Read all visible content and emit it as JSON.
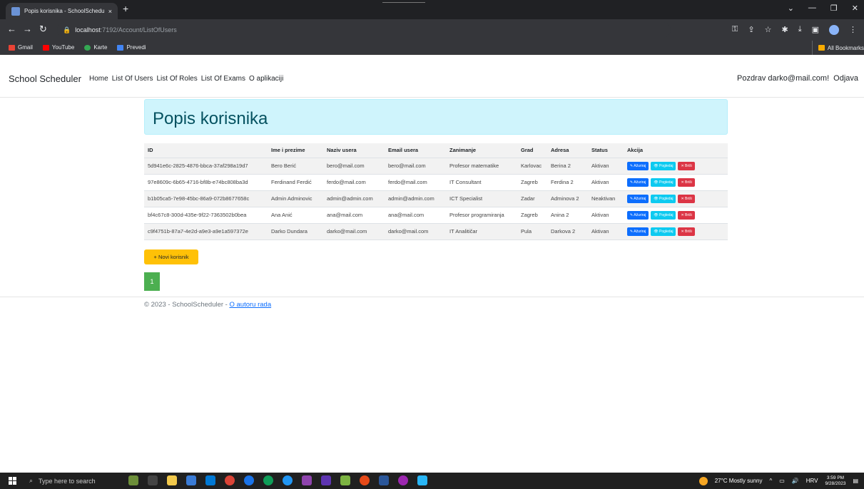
{
  "browser": {
    "tab_title": "Popis korisnika - SchoolScheduler",
    "tab_close": "×",
    "new_tab": "+",
    "url_host": "localhost",
    "url_path": ":7192/Account/ListOfUsers",
    "bookmarks": [
      {
        "label": "Gmail",
        "color": "#ea4335"
      },
      {
        "label": "YouTube",
        "color": "#ff0000"
      },
      {
        "label": "Karte",
        "color": "#34a853"
      },
      {
        "label": "Prevedi",
        "color": "#4285f4"
      }
    ],
    "all_bookmarks": "All Bookmarks"
  },
  "navbar": {
    "brand": "School Scheduler",
    "links": [
      "Home",
      "List Of Users",
      "List Of Roles",
      "List Of Exams",
      "O aplikaciji"
    ],
    "greeting": "Pozdrav darko@mail.com!",
    "logout": "Odjava"
  },
  "main": {
    "title": "Popis korisnika",
    "columns": [
      "ID",
      "Ime i prezime",
      "Naziv usera",
      "Email usera",
      "Zanimanje",
      "Grad",
      "Adresa",
      "Status",
      "Akcija"
    ],
    "rows": [
      [
        "5d941e6c-2825-4876-bbca-37af298a19d7",
        "Bero Berić",
        "bero@mail.com",
        "bero@mail.com",
        "Profesor matematike",
        "Karlovac",
        "Berina 2",
        "Aktivan"
      ],
      [
        "97e8609c-6b65-4716-bf8b-e74bc808ba3d",
        "Ferdinand Ferdić",
        "ferdo@mail.com",
        "ferdo@mail.com",
        "IT Consultant",
        "Zagreb",
        "Ferdina 2",
        "Aktivan"
      ],
      [
        "b1b05ca5-7e98-45bc-86a9-072b8677658c",
        "Admin Adminovic",
        "admin@admin.com",
        "admin@admin.com",
        "ICT Specialist",
        "Zadar",
        "Adminova 2",
        "Neaktivan"
      ],
      [
        "bf4c67c8-300d-435e-9f22-7363502b0bea",
        "Ana Anić",
        "ana@mail.com",
        "ana@mail.com",
        "Profesor programiranja",
        "Zagreb",
        "Anina 2",
        "Aktivan"
      ],
      [
        "c9f4751b-87a7-4e2d-a9e3-a9e1a597372e",
        "Darko Dundara",
        "darko@mail.com",
        "darko@mail.com",
        "IT Analitičar",
        "Pula",
        "Darkova 2",
        "Aktivan"
      ]
    ],
    "actions": {
      "update": "✎ Ažuriraj",
      "view": "👁 Pogledaj",
      "delete": "✕ Briši"
    },
    "new_user": "+ Novi korisnik",
    "page": "1"
  },
  "footer": {
    "text": "© 2023 - SchoolScheduler - ",
    "link": "O autoru rada"
  },
  "taskbar": {
    "search_placeholder": "Type here to search",
    "weather": "27°C  Mostly sunny",
    "lang": "HRV",
    "time": "3:59 PM",
    "date": "9/28/2023"
  }
}
